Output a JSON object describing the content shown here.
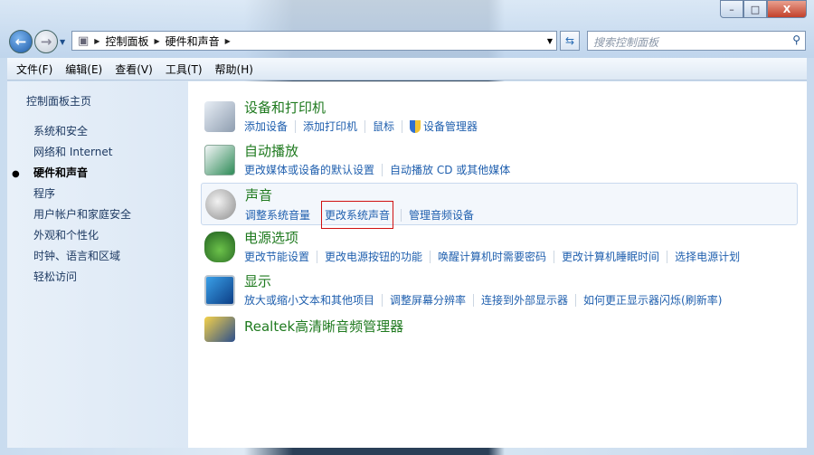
{
  "window": {
    "minimize": "–",
    "maximize": "□",
    "close": "X"
  },
  "address": {
    "crumbs": [
      "控制面板",
      "硬件和声音"
    ],
    "search_placeholder": "搜索控制面板"
  },
  "menu": [
    "文件(F)",
    "编辑(E)",
    "查看(V)",
    "工具(T)",
    "帮助(H)"
  ],
  "sidebar": {
    "home": "控制面板主页",
    "items": [
      "系统和安全",
      "网络和 Internet",
      "硬件和声音",
      "程序",
      "用户帐户和家庭安全",
      "外观和个性化",
      "时钟、语言和区域",
      "轻松访问"
    ],
    "current": "硬件和声音"
  },
  "sections": [
    {
      "title": "设备和打印机",
      "links": [
        "添加设备",
        "添加打印机",
        "鼠标",
        "设备管理器"
      ]
    },
    {
      "title": "自动播放",
      "links": [
        "更改媒体或设备的默认设置",
        "自动播放 CD 或其他媒体"
      ]
    },
    {
      "title": "声音",
      "links": [
        "调整系统音量",
        "更改系统声音",
        "管理音频设备"
      ]
    },
    {
      "title": "电源选项",
      "links": [
        "更改节能设置",
        "更改电源按钮的功能",
        "唤醒计算机时需要密码",
        "更改计算机睡眠时间",
        "选择电源计划"
      ]
    },
    {
      "title": "显示",
      "links": [
        "放大或缩小文本和其他项目",
        "调整屏幕分辨率",
        "连接到外部显示器",
        "如何更正显示器闪烁(刷新率)"
      ]
    },
    {
      "title": "Realtek高清晰音频管理器",
      "links": []
    }
  ]
}
